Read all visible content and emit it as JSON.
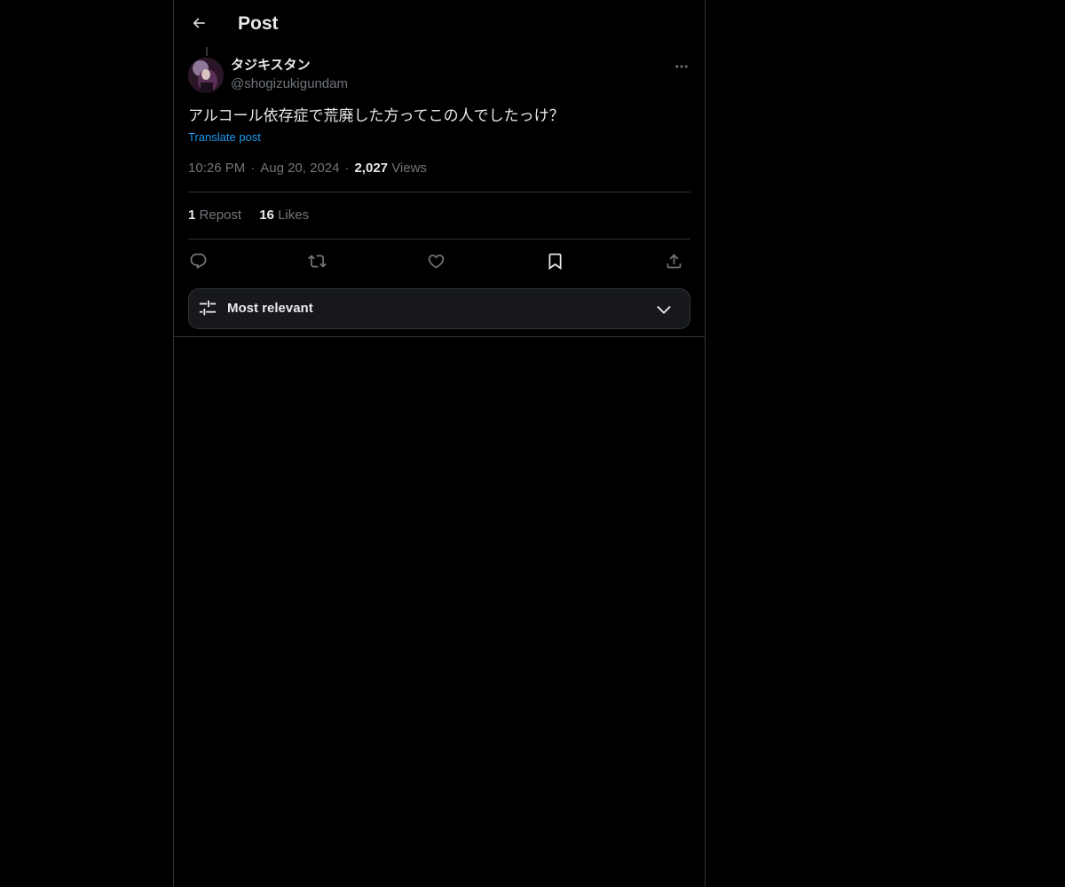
{
  "header": {
    "title": "Post",
    "back_icon": "arrow-left-icon"
  },
  "post": {
    "author": {
      "display_name": "タジキスタン",
      "handle": "@shogizukigundam"
    },
    "text": "アルコール依存症で荒廃した方ってこの人でしたっけ？",
    "translate_label": "Translate post",
    "time": "10:26 PM",
    "separator": "·",
    "date": "Aug 20, 2024",
    "views_count": "2,027",
    "views_label": "Views",
    "stats": {
      "reposts_count": "1",
      "reposts_label": "Repost",
      "likes_count": "16",
      "likes_label": "Likes"
    },
    "actions": [
      "reply-icon",
      "repost-icon",
      "like-icon",
      "bookmark-icon",
      "share-icon"
    ]
  },
  "sort": {
    "label": "Most relevant",
    "icon": "sliders-icon",
    "chevron": "chevron-down-icon"
  },
  "colors": {
    "background": "#000000",
    "text_primary": "#e7e9ea",
    "text_secondary": "#71767b",
    "link": "#1d9bf0",
    "border": "#2f3336"
  }
}
